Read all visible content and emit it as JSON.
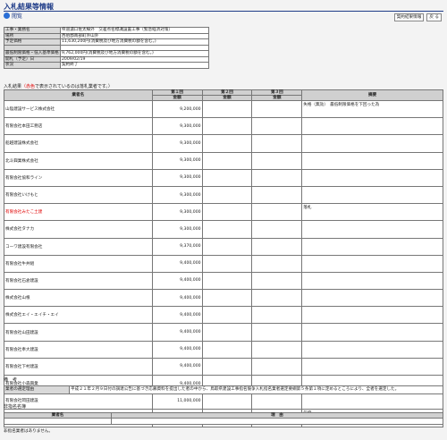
{
  "header": {
    "title": "入札結果等情報",
    "subtitle": "閲覧",
    "btn_contract": "契約結果情報",
    "btn_back": "戻 る"
  },
  "info": [
    {
      "label": "工事・業務名",
      "value": "県道濃口佐太線外　交差点名標識設置工事（緊急経済対策）"
    },
    {
      "label": "場所",
      "value": "西伯郡南部町外山外"
    },
    {
      "label": "予定価格",
      "value": "11,630,200円(消費税及び地方消費税の額を含む。)"
    },
    {
      "label": "",
      "value": ""
    },
    {
      "label": "最低制限価格・低入基準価格",
      "value": "9,762,000円(消費税及び地方消費税の額を含む。)"
    },
    {
      "label": "開札（予定）日",
      "value": "2009/02/19"
    },
    {
      "label": "状況",
      "value": "契約終了"
    }
  ],
  "bid_section": {
    "label": "入札結果",
    "note_red": "（赤色",
    "note_rest": "で表示されているのは落札業者です。）"
  },
  "bid_headers": {
    "name": "業者名",
    "r1": "第１回",
    "r2": "第２回",
    "r3": "第３回",
    "amount": "金額",
    "remark": "摘要"
  },
  "bidders": [
    {
      "name": "山陰建設サービス株式会社",
      "amt": "9,200,000",
      "remark": "失格（無効）　最低制限価格を下回った為",
      "winner": false
    },
    {
      "name": "有限会社本田工務店",
      "amt": "9,300,000",
      "remark": "",
      "winner": false
    },
    {
      "name": "船越建設株式会社",
      "amt": "9,300,000",
      "remark": "",
      "winner": false
    },
    {
      "name": "北斗興業株式会社",
      "amt": "9,300,000",
      "remark": "",
      "winner": false
    },
    {
      "name": "有限会社協和ライン",
      "amt": "9,300,000",
      "remark": "",
      "winner": false
    },
    {
      "name": "有限会社いけもと",
      "amt": "9,300,000",
      "remark": "",
      "winner": false
    },
    {
      "name": "有限会社みたこ土建",
      "amt": "9,300,000",
      "remark": "落札",
      "winner": true
    },
    {
      "name": "株式会社タナカ",
      "amt": "9,300,000",
      "remark": "",
      "winner": false
    },
    {
      "name": "コーワ建設有限会社",
      "amt": "9,370,000",
      "remark": "",
      "winner": false
    },
    {
      "name": "有限会社牛井組",
      "amt": "9,400,000",
      "remark": "",
      "winner": false
    },
    {
      "name": "有限会社石倉建設",
      "amt": "9,400,000",
      "remark": "",
      "winner": false
    },
    {
      "name": "株式会社山根",
      "amt": "9,400,000",
      "remark": "",
      "winner": false
    },
    {
      "name": "株式会社エイ・エイチ・エイ",
      "amt": "9,400,000",
      "remark": "",
      "winner": false
    },
    {
      "name": "有限会社山田建設",
      "amt": "9,400,000",
      "remark": "",
      "winner": false
    },
    {
      "name": "有限会社奉大建設",
      "amt": "9,400,000",
      "remark": "",
      "winner": false
    },
    {
      "name": "有限会社下村建設",
      "amt": "9,400,000",
      "remark": "",
      "winner": false
    },
    {
      "name": "有限会社小森興業",
      "amt": "9,400,000",
      "remark": "",
      "winner": false
    },
    {
      "name": "有限会社岡田建設",
      "amt": "11,000,000",
      "remark": "",
      "winner": false
    },
    {
      "name": "有限会社門脇組",
      "amt": "",
      "remark": "欠席",
      "winner": false
    }
  ],
  "remarks": {
    "section": "備　考",
    "label": "業者の選定理由",
    "text": "平成２１年２月９日付の調達公告に基づき応募資料を提出した者の中から、鳥取県建設工事指名競争入札指名業者選定要綱第５条第１項に定めるところにより、全者を選定した。"
  },
  "nominated": {
    "section": "非指名名簿",
    "col_name": "業者名",
    "col_reason": "理　由",
    "empty_note": "非指名業者はありません。"
  }
}
